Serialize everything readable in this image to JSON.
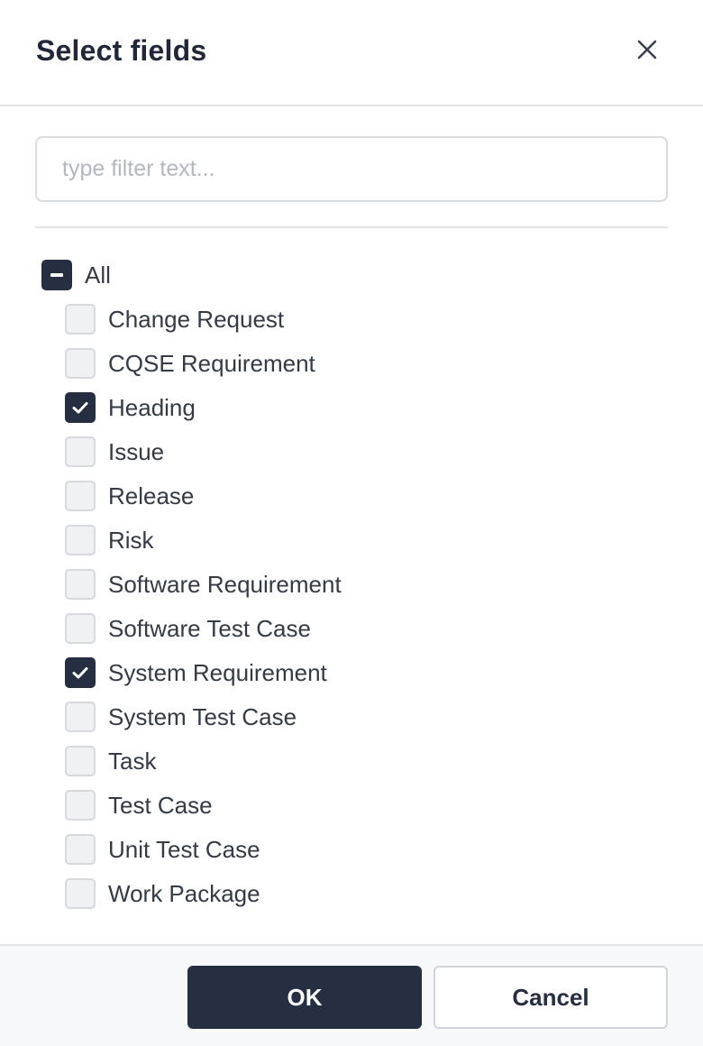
{
  "dialog": {
    "title": "Select fields",
    "close_icon": "close-icon"
  },
  "filter": {
    "placeholder": "type filter text...",
    "value": ""
  },
  "tree": {
    "all": {
      "label": "All",
      "state": "indeterminate"
    },
    "items": [
      {
        "label": "Change Request",
        "checked": false
      },
      {
        "label": "CQSE Requirement",
        "checked": false
      },
      {
        "label": "Heading",
        "checked": true
      },
      {
        "label": "Issue",
        "checked": false
      },
      {
        "label": "Release",
        "checked": false
      },
      {
        "label": "Risk",
        "checked": false
      },
      {
        "label": "Software Requirement",
        "checked": false
      },
      {
        "label": "Software Test Case",
        "checked": false
      },
      {
        "label": "System Requirement",
        "checked": true
      },
      {
        "label": "System Test Case",
        "checked": false
      },
      {
        "label": "Task",
        "checked": false
      },
      {
        "label": "Test Case",
        "checked": false
      },
      {
        "label": "Unit Test Case",
        "checked": false
      },
      {
        "label": "Work Package",
        "checked": false
      }
    ]
  },
  "footer": {
    "ok_label": "OK",
    "cancel_label": "Cancel"
  },
  "colors": {
    "primary": "#262f42",
    "checkbox_unchecked": "#f0f1f3",
    "text": "#343b47"
  }
}
